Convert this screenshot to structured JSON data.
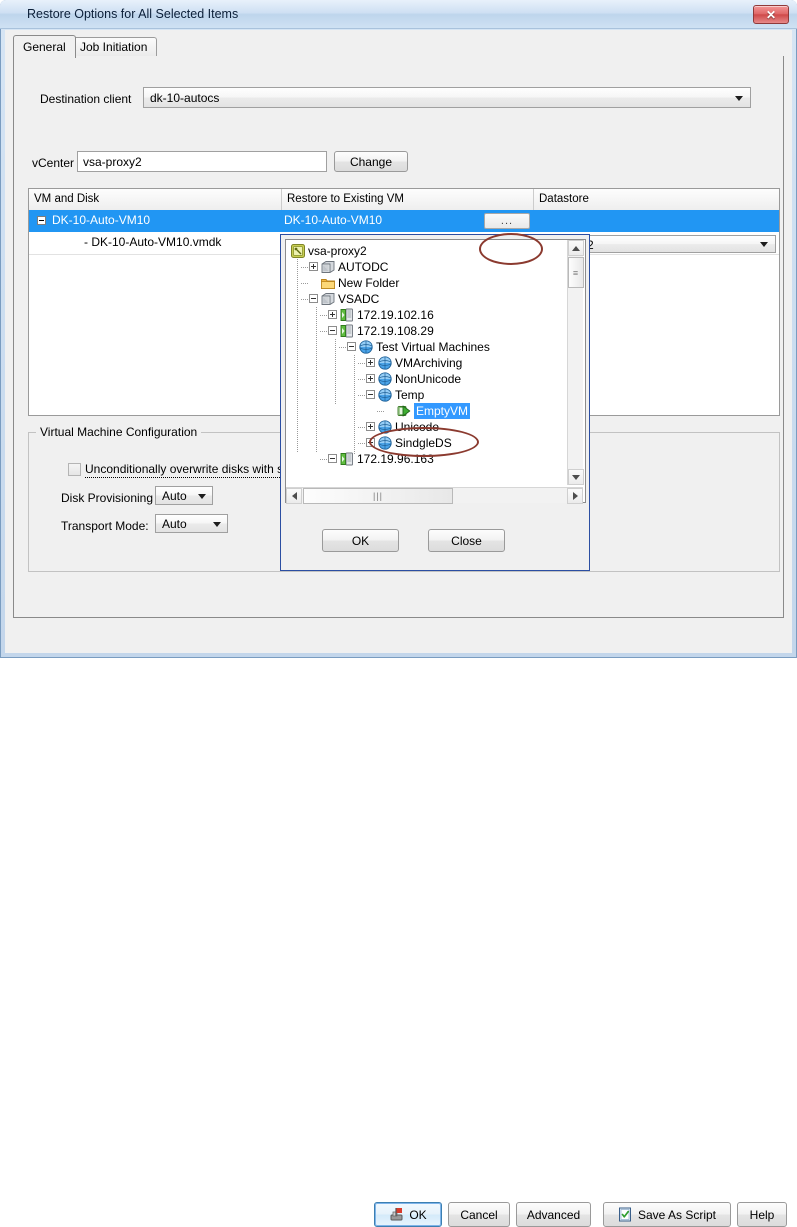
{
  "window": {
    "title": "Restore Options for All Selected Items",
    "close_label": "✕"
  },
  "tabs": [
    {
      "label": "General",
      "active": true
    },
    {
      "label": "Job Initiation",
      "active": false
    }
  ],
  "form": {
    "destination_client_label": "Destination client",
    "destination_client_value": "dk-10-autocs",
    "vcenter_label": "vCenter",
    "vcenter_value": "vsa-proxy2",
    "change_button": "Change"
  },
  "grid": {
    "columns": [
      "VM and Disk",
      "Restore to Existing VM",
      "Datastore"
    ],
    "rows": [
      {
        "vm_and_disk": "DK-10-Auto-VM10",
        "restore_to_existing_vm": "DK-10-Auto-VM10",
        "datastore": "",
        "selected": true,
        "expander": "minus",
        "ellipsis_button": "..."
      },
      {
        "vm_and_disk": "- DK-10-Auto-VM10.vmdk",
        "restore_to_existing_vm": "",
        "datastore": "2",
        "selected": false,
        "expander": "none"
      }
    ]
  },
  "vm_config": {
    "group_title": "Virtual Machine Configuration",
    "overwrite_label": "Unconditionally overwrite disks with same",
    "overwrite_checked": false,
    "disk_provisioning_label": "Disk Provisioning",
    "disk_provisioning_value": "Auto",
    "transport_mode_label": "Transport Mode:",
    "transport_mode_value": "Auto"
  },
  "tree_popup": {
    "ok_button": "OK",
    "close_button": "Close",
    "nodes": [
      {
        "label": "vsa-proxy2",
        "depth": 0,
        "expander": "none",
        "icon": "vcenter-icon",
        "selected": false
      },
      {
        "label": "AUTODC",
        "depth": 1,
        "expander": "plus",
        "icon": "datacenter-icon",
        "selected": false
      },
      {
        "label": "New Folder",
        "depth": 1,
        "expander": "none",
        "icon": "folder-icon",
        "selected": false
      },
      {
        "label": "VSADC",
        "depth": 1,
        "expander": "minus",
        "icon": "datacenter-icon",
        "selected": false
      },
      {
        "label": "172.19.102.16",
        "depth": 2,
        "expander": "plus",
        "icon": "host-icon",
        "selected": false
      },
      {
        "label": "172.19.108.29",
        "depth": 2,
        "expander": "minus",
        "icon": "host-icon",
        "selected": false
      },
      {
        "label": "Test Virtual Machines",
        "depth": 3,
        "expander": "minus",
        "icon": "resourcepool-icon",
        "selected": false
      },
      {
        "label": "VMArchiving",
        "depth": 4,
        "expander": "plus",
        "icon": "resourcepool-icon",
        "selected": false
      },
      {
        "label": "NonUnicode",
        "depth": 4,
        "expander": "plus",
        "icon": "resourcepool-icon",
        "selected": false
      },
      {
        "label": "Temp",
        "depth": 4,
        "expander": "minus",
        "icon": "resourcepool-icon",
        "selected": false
      },
      {
        "label": "EmptyVM",
        "depth": 5,
        "expander": "none",
        "icon": "vm-poweron-icon",
        "selected": true
      },
      {
        "label": "Unicode",
        "depth": 4,
        "expander": "plus",
        "icon": "resourcepool-icon",
        "selected": false
      },
      {
        "label": "SindgleDS",
        "depth": 4,
        "expander": "plus",
        "icon": "resourcepool-icon",
        "selected": false
      },
      {
        "label": "172.19.96.163",
        "depth": 2,
        "expander": "minus",
        "icon": "host-icon",
        "selected": false
      }
    ]
  },
  "footer": {
    "ok": "OK",
    "cancel": "Cancel",
    "advanced": "Advanced",
    "save_as_script": "Save As Script",
    "help": "Help"
  },
  "colors": {
    "selection_blue": "#2196f3",
    "tree_selection_blue": "#3399ff",
    "annotation_red": "#8b3a2f",
    "title_gradient_top": "#e8f1fb",
    "dialog_bg": "#f0f0f0",
    "popup_border": "#2b4ea2"
  }
}
